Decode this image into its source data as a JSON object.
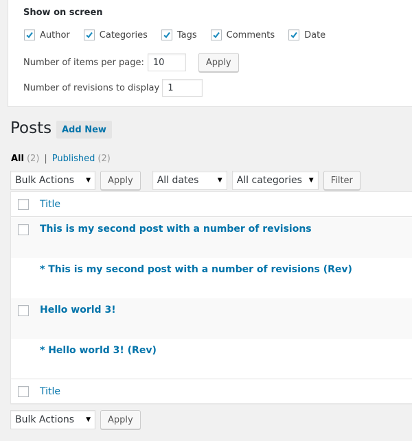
{
  "screen_options": {
    "title": "Show on screen",
    "columns": [
      {
        "label": "Author",
        "checked": true
      },
      {
        "label": "Categories",
        "checked": true
      },
      {
        "label": "Tags",
        "checked": true
      },
      {
        "label": "Comments",
        "checked": true
      },
      {
        "label": "Date",
        "checked": true
      }
    ],
    "items_per_page_label": "Number of items per page:",
    "items_per_page_value": "10",
    "apply_label": "Apply",
    "revisions_label": "Number of revisions to display",
    "revisions_value": "1"
  },
  "page": {
    "title": "Posts",
    "add_new_label": "Add New"
  },
  "filters": {
    "all_label": "All",
    "all_count": "(2)",
    "separator": "|",
    "published_label": "Published",
    "published_count": "(2)"
  },
  "tablenav_top": {
    "bulk_actions": "Bulk Actions",
    "apply_label": "Apply",
    "dates": "All dates",
    "categories": "All categories",
    "filter_label": "Filter"
  },
  "table": {
    "header_title": "Title",
    "footer_title": "Title",
    "rows": [
      {
        "title": "This is my second post with a number of revisions",
        "has_checkbox": true
      },
      {
        "title": "* This is my second post with a number of revisions (Rev)",
        "has_checkbox": false
      },
      {
        "title": "Hello world 3!",
        "has_checkbox": true
      },
      {
        "title": "* Hello world 3! (Rev)",
        "has_checkbox": false
      }
    ]
  },
  "tablenav_bottom": {
    "bulk_actions": "Bulk Actions",
    "apply_label": "Apply"
  },
  "colors": {
    "link": "#0073aa",
    "checkmark": "#1e8cbe",
    "background": "#f1f1f1"
  }
}
